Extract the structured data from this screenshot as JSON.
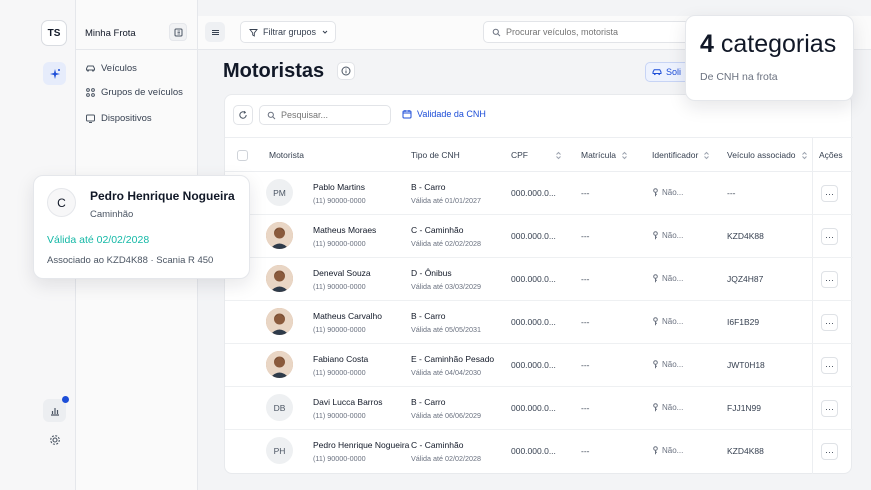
{
  "rail": {
    "org_initials": "TS",
    "icons": [
      "sparkle-icon",
      "chart-icon",
      "gear-icon"
    ]
  },
  "sidebar": {
    "fleet_name": "Minha Frota",
    "items": [
      {
        "label": "Veículos",
        "icon": "car-icon"
      },
      {
        "label": "Grupos de veículos",
        "icon": "group-icon"
      },
      {
        "label": "Dispositivos",
        "icon": "device-icon"
      }
    ]
  },
  "topbar": {
    "filter_label": "Filtrar grupos",
    "search_placeholder": "Procurar veículos, motorista"
  },
  "page": {
    "title": "Motoristas",
    "request_button": "Soli"
  },
  "toolbar": {
    "search_placeholder": "Pesquisar...",
    "validity_label": "Validade da CNH"
  },
  "table": {
    "headers": {
      "driver": "Motorista",
      "cnh_type": "Tipo de CNH",
      "cpf": "CPF",
      "registration": "Matrícula",
      "identifier": "Identificador",
      "vehicle": "Veículo associado",
      "actions": "Ações"
    },
    "rows": [
      {
        "initials": "PM",
        "photo": false,
        "name": "Pablo Martins",
        "phone": "(11) 90000-0000",
        "cnh": "B - Carro",
        "validity": "Válida até 01/01/2027",
        "cpf": "000.000.0...",
        "registration": "---",
        "identifier": "Não...",
        "vehicle": "---",
        "more": "···"
      },
      {
        "initials": "",
        "photo": true,
        "name": "Matheus Moraes",
        "phone": "(11) 90000-0000",
        "cnh": "C - Caminhão",
        "validity": "Válida até 02/02/2028",
        "cpf": "000.000.0...",
        "registration": "---",
        "identifier": "Não...",
        "vehicle": "KZD4K88",
        "more": "···"
      },
      {
        "initials": "",
        "photo": true,
        "name": "Deneval Souza",
        "phone": "(11) 90000-0000",
        "cnh": "D - Ônibus",
        "validity": "Válida até 03/03/2029",
        "cpf": "000.000.0...",
        "registration": "---",
        "identifier": "Não...",
        "vehicle": "JQZ4H87",
        "more": "···"
      },
      {
        "initials": "",
        "photo": true,
        "name": "Matheus Carvalho",
        "phone": "(11) 90000-0000",
        "cnh": "B - Carro",
        "validity": "Válida até 05/05/2031",
        "cpf": "000.000.0...",
        "registration": "---",
        "identifier": "Não...",
        "vehicle": "I6F1B29",
        "more": "···"
      },
      {
        "initials": "",
        "photo": true,
        "name": "Fabiano Costa",
        "phone": "(11) 90000-0000",
        "cnh": "E - Caminhão Pesado",
        "validity": "Válida até 04/04/2030",
        "cpf": "000.000.0...",
        "registration": "---",
        "identifier": "Não...",
        "vehicle": "JWT0H18",
        "more": "···"
      },
      {
        "initials": "DB",
        "photo": false,
        "name": "Davi Lucca Barros",
        "phone": "(11) 90000-0000",
        "cnh": "B - Carro",
        "validity": "Válida até 06/06/2029",
        "cpf": "000.000.0...",
        "registration": "---",
        "identifier": "Não...",
        "vehicle": "FJJ1N99",
        "more": "···"
      },
      {
        "initials": "PH",
        "photo": false,
        "name": "Pedro Henrique Nogueira",
        "phone": "(11) 90000-0000",
        "cnh": "C - Caminhão",
        "validity": "Válida até 02/02/2028",
        "cpf": "000.000.0...",
        "registration": "---",
        "identifier": "Não...",
        "vehicle": "KZD4K88",
        "more": "···"
      }
    ]
  },
  "driver_card": {
    "initial": "C",
    "name": "Pedro Henrique Nogueira",
    "category": "Caminhão",
    "validity": "Válida até 02/02/2028",
    "association": "Associado ao KZD4K88 · Scania R 450"
  },
  "stat_card": {
    "value": "4",
    "label": "categorias",
    "subtitle": "De CNH na frota"
  },
  "colors": {
    "accent": "#1d4ed8",
    "valid": "#14b8a6",
    "text": "#111827"
  }
}
